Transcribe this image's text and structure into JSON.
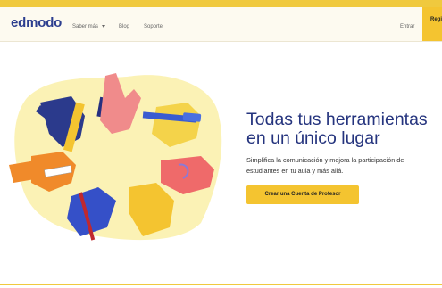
{
  "header": {
    "logo": "edmodo",
    "nav": [
      {
        "label": "Saber más"
      },
      {
        "label": "Blog"
      },
      {
        "label": "Soporte"
      }
    ],
    "login": "Entrar",
    "register": "Regi"
  },
  "hero": {
    "title_line1": "Todas tus herramientas",
    "title_line2": "en un único lugar",
    "subtitle_line1": "Simplifica la comunicación y mejora la participación de",
    "subtitle_line2": "estudiantes en tu aula y más allá.",
    "cta": "Crear una Cuenta de Profesor"
  },
  "colors": {
    "accent": "#f4c430",
    "brand": "#2c3e8f",
    "headline": "#25347e"
  }
}
